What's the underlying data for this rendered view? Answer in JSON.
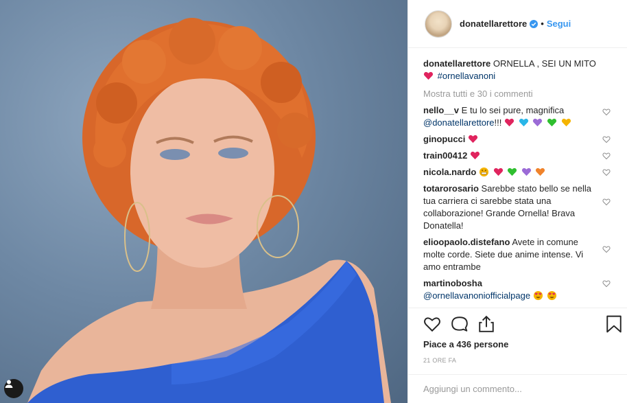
{
  "post": {
    "username": "donatellarettore",
    "dot": "•",
    "follow_label": "Segui",
    "caption_text": "ORNELLA , SEI UN MITO",
    "caption_hashtag": "#ornellavanoni",
    "show_all": "Mostra tutti e 30 i commenti"
  },
  "comments": [
    {
      "user": "nello__v",
      "text": "E tu lo sei pure, magnifica",
      "mention": "@donatellarettore",
      "suffix": "!!!"
    },
    {
      "user": "ginopucci"
    },
    {
      "user": "train00412"
    },
    {
      "user": "nicola.nardo"
    },
    {
      "user": "totarorosario",
      "text": "Sarebbe stato bello se nella tua carriera ci sarebbe stata una collaborazione! Grande Ornella! Brava Donatella!"
    },
    {
      "user": "elioopaolo.distefano",
      "text": "Avete in comune molte corde. Siete due anime intense. Vi amo entrambe"
    },
    {
      "user": "martinobosha",
      "mention": "@ornellavanoniofficialpage"
    }
  ],
  "emoji_colors": {
    "red": "#e0245e",
    "cyan": "#29b6e8",
    "purple": "#9b6bd6",
    "green": "#2fbf2f",
    "yellow": "#f5b400",
    "orange": "#f0832b"
  },
  "likes": "Piace a 436 persone",
  "time": "21 ORE FA",
  "add_comment_placeholder": "Aggiungi un commento...",
  "icons": [
    "heart-icon",
    "comment-icon",
    "share-icon",
    "bookmark-icon",
    "user-tag-icon",
    "verified-badge-icon"
  ],
  "colors": {
    "link": "#3897f0",
    "hashtag": "#003569",
    "muted": "#999999"
  }
}
